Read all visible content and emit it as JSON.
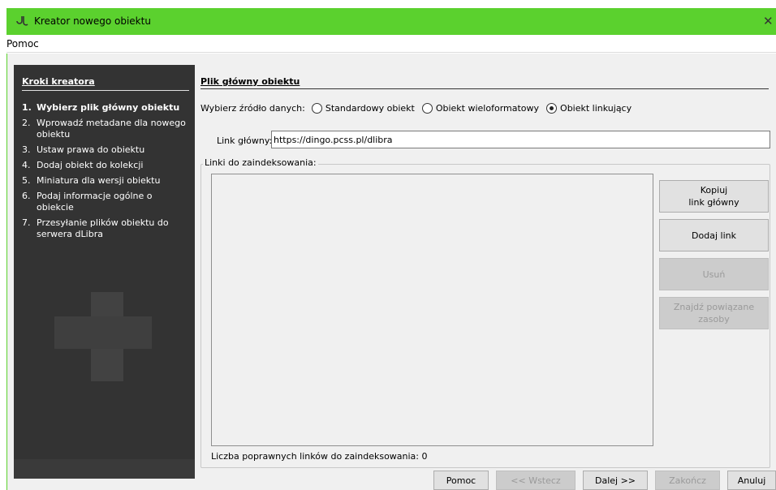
{
  "window": {
    "title": "Kreator nowego obiektu",
    "close_glyph": "✕"
  },
  "menu": {
    "items": [
      "Pomoc"
    ]
  },
  "sidebar": {
    "heading": "Kroki kreatora",
    "steps": [
      {
        "num": "1.",
        "label": "Wybierz plik główny obiektu",
        "active": true
      },
      {
        "num": "2.",
        "label": "Wprowadź metadane dla nowego obiektu"
      },
      {
        "num": "3.",
        "label": "Ustaw prawa do obiektu"
      },
      {
        "num": "4.",
        "label": "Dodaj obiekt do kolekcji"
      },
      {
        "num": "5.",
        "label": "Miniatura dla wersji obiektu"
      },
      {
        "num": "6.",
        "label": "Podaj informacje ogólne o obiekcie"
      },
      {
        "num": "7.",
        "label": "Przesyłanie plików obiektu do serwera dLibra"
      }
    ]
  },
  "main": {
    "title": "Plik główny obiektu",
    "source_label": "Wybierz źródło danych:",
    "source_options": [
      {
        "label": "Standardowy obiekt",
        "checked": false
      },
      {
        "label": "Obiekt wieloformatowy",
        "checked": false
      },
      {
        "label": "Obiekt linkujący",
        "checked": true
      }
    ],
    "link_label": "Link główny:",
    "link_value": "https://dingo.pcss.pl/dlibra",
    "links_legend": "Linki do zaindeksowania:",
    "count_text": "Liczba poprawnych linków do zaindeksowania: 0",
    "buttons": {
      "copy": "Kopiuj\nlink główny",
      "add": "Dodaj link",
      "remove": "Usuń",
      "find": "Znajdź powiązane\nzasoby"
    }
  },
  "footer": {
    "help": "Pomoc",
    "back": "<< Wstecz",
    "next": "Dalej >>",
    "finish": "Zakończ",
    "cancel": "Anuluj"
  },
  "colors": {
    "titlebar": "#5bd12e",
    "sidebar": "#333333"
  }
}
